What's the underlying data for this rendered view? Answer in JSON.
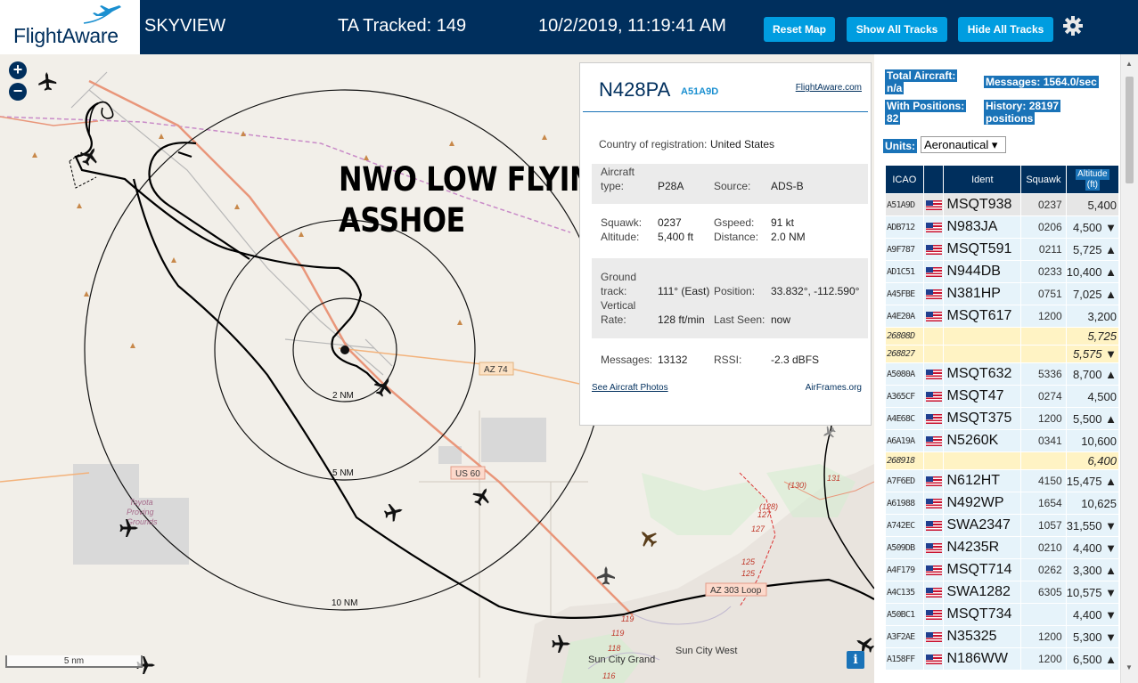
{
  "header": {
    "brand": "FlightAware",
    "app_name": "SKYVIEW",
    "tracked": "TA Tracked: 149",
    "datetime": "10/2/2019, 11:19:41 AM",
    "buttons": {
      "reset": "Reset Map",
      "show": "Show All Tracks",
      "hide": "Hide All Tracks"
    },
    "accent_color": "#009de0",
    "bar_color": "#002f5d"
  },
  "map": {
    "zoom_in": "+",
    "zoom_out": "−",
    "overlay_line1": "NWO LOW FLYING",
    "overlay_line2": "ASSHOE",
    "ring_labels": [
      "2 NM",
      "5 NM",
      "10 NM"
    ],
    "road_labels": {
      "az74": "AZ 74",
      "us60": "US 60",
      "az303": "AZ 303 Loop"
    },
    "place_labels": {
      "proving_1": "Toyota",
      "proving_2": "Proving",
      "proving_3": "Grounds",
      "scg": "Sun City Grand",
      "scw": "Sun City West"
    },
    "route_numbers": [
      "(130)",
      "131",
      "(128)",
      "127",
      "127",
      "125",
      "125",
      "119",
      "119",
      "118",
      "116"
    ],
    "scale": "5 nm",
    "info": "i"
  },
  "selected": {
    "registration": "N428PA",
    "icao": "A51A9D",
    "fa_link": "FlightAware.com",
    "country_label": "Country of registration:",
    "country": "United States",
    "aircraft_type_l1": "Aircraft",
    "aircraft_type_l2": "type:",
    "aircraft_type": "P28A",
    "source_label": "Source:",
    "source": "ADS-B",
    "squawk_label": "Squawk:",
    "squawk": "0237",
    "gspeed_label": "Gspeed:",
    "gspeed": "91 kt",
    "altitude_label": "Altitude:",
    "altitude": "5,400 ft",
    "distance_label": "Distance:",
    "distance": "2.0 NM",
    "track_l1": "Ground",
    "track_l2": "track:",
    "track": "111° (East)",
    "position_label": "Position:",
    "position": "33.832°, -112.590°",
    "vrate_l1": "Vertical",
    "vrate_l2": "Rate:",
    "vrate": "128 ft/min",
    "lastseen_label": "Last Seen:",
    "lastseen": "now",
    "messages_label": "Messages:",
    "messages": "13132",
    "rssi_label": "RSSI:",
    "rssi": "-2.3 dBFS",
    "photos_link": "See Aircraft Photos",
    "airframes": "AirFrames.org"
  },
  "sidebar": {
    "total_label": "Total Aircraft:",
    "total": "n/a",
    "withpos_label": "With Positions:",
    "withpos": "82",
    "messages_label": "Messages:",
    "messages": "1564.0/sec",
    "history_label": "History:",
    "history_value": "28197",
    "history_unit": "positions",
    "units_label": "Units:",
    "units_value": "Aeronautical ▾",
    "columns": {
      "icao": "ICAO",
      "ident": "Ident",
      "squawk": "Squawk",
      "altitude_1": "Altitude",
      "altitude_2": "(ft)"
    },
    "rows": [
      {
        "icao": "A51A9D",
        "ident": "MSQT938",
        "squawk": "0237",
        "alt": "5,400",
        "flag": true,
        "sel": true
      },
      {
        "icao": "ADB712",
        "ident": "N983JA",
        "squawk": "0206",
        "alt": "4,500 ▼",
        "flag": true
      },
      {
        "icao": "A9F787",
        "ident": "MSQT591",
        "squawk": "0211",
        "alt": "5,725 ▲",
        "flag": true
      },
      {
        "icao": "AD1C51",
        "ident": "N944DB",
        "squawk": "0233",
        "alt": "10,400 ▲",
        "flag": true
      },
      {
        "icao": "A45FBE",
        "ident": "N381HP",
        "squawk": "0751",
        "alt": "7,025 ▲",
        "flag": true
      },
      {
        "icao": "A4E20A",
        "ident": "MSQT617",
        "squawk": "1200",
        "alt": "3,200",
        "flag": true
      },
      {
        "icao": "26808D",
        "ident": "",
        "squawk": "",
        "alt": "5,725",
        "flag": false,
        "nopos": true
      },
      {
        "icao": "268827",
        "ident": "",
        "squawk": "",
        "alt": "5,575 ▼",
        "flag": false,
        "nopos": true
      },
      {
        "icao": "A5080A",
        "ident": "MSQT632",
        "squawk": "5336",
        "alt": "8,700 ▲",
        "flag": true
      },
      {
        "icao": "A365CF",
        "ident": "MSQT47",
        "squawk": "0274",
        "alt": "4,500",
        "flag": true
      },
      {
        "icao": "A4E68C",
        "ident": "MSQT375",
        "squawk": "1200",
        "alt": "5,500 ▲",
        "flag": true
      },
      {
        "icao": "A6A19A",
        "ident": "N5260K",
        "squawk": "0341",
        "alt": "10,600",
        "flag": true
      },
      {
        "icao": "268918",
        "ident": "",
        "squawk": "",
        "alt": "6,400",
        "flag": false,
        "nopos": true
      },
      {
        "icao": "A7F6ED",
        "ident": "N612HT",
        "squawk": "4150",
        "alt": "15,475 ▲",
        "flag": true
      },
      {
        "icao": "A61988",
        "ident": "N492WP",
        "squawk": "1654",
        "alt": "10,625",
        "flag": true
      },
      {
        "icao": "A742EC",
        "ident": "SWA2347",
        "squawk": "1057",
        "alt": "31,550 ▼",
        "flag": true
      },
      {
        "icao": "A509DB",
        "ident": "N4235R",
        "squawk": "0210",
        "alt": "4,400 ▼",
        "flag": true
      },
      {
        "icao": "A4F179",
        "ident": "MSQT714",
        "squawk": "0262",
        "alt": "3,300 ▲",
        "flag": true
      },
      {
        "icao": "A4C135",
        "ident": "SWA1282",
        "squawk": "6305",
        "alt": "10,575 ▼",
        "flag": true
      },
      {
        "icao": "A50BC1",
        "ident": "MSQT734",
        "squawk": "",
        "alt": "4,400 ▼",
        "flag": true
      },
      {
        "icao": "A3F2AE",
        "ident": "N35325",
        "squawk": "1200",
        "alt": "5,300 ▼",
        "flag": true
      },
      {
        "icao": "A158FF",
        "ident": "N186WW",
        "squawk": "1200",
        "alt": "6,500 ▲",
        "flag": true
      }
    ]
  }
}
